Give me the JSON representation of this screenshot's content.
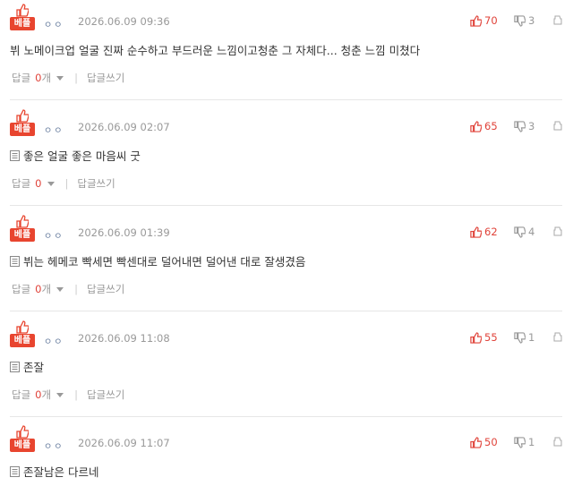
{
  "labels": {
    "best": "베플",
    "reply": "답글",
    "reply_unit": "개",
    "write_reply": "답글쓰기"
  },
  "colors": {
    "best_badge": "#e8452f",
    "upvote": "#e0433a",
    "meta": "#999999",
    "nickname": "#6a7fa0"
  },
  "comments": [
    {
      "nickname": "ㅇㅇ",
      "date": "2026.06.09 09:36",
      "up": "70",
      "down": "3",
      "text": "뷔 노메이크업 얼굴 진짜 순수하고 부드러운 느낌이고청춘 그 자체다... 청춘 느낌 미쳤다",
      "replies": "0",
      "has_doc_icon": false
    },
    {
      "nickname": "ㅇㅇ",
      "date": "2026.06.09 02:07",
      "up": "65",
      "down": "3",
      "text": "좋은 얼굴 좋은 마음씨 굿",
      "replies": "0",
      "has_doc_icon": true
    },
    {
      "nickname": "ㅇㅇ",
      "date": "2026.06.09 01:39",
      "up": "62",
      "down": "4",
      "text": "뷔는 헤메코 빡세면 빡센대로 덜어내면 덜어낸 대로 잘생겼음",
      "replies": "0",
      "has_doc_icon": true
    },
    {
      "nickname": "ㅇㅇ",
      "date": "2026.06.09 11:08",
      "up": "55",
      "down": "1",
      "text": "존잘",
      "replies": "0",
      "has_doc_icon": true
    },
    {
      "nickname": "ㅇㅇ",
      "date": "2026.06.09 11:07",
      "up": "50",
      "down": "1",
      "text": "존잘남은 다르네",
      "replies": "0",
      "has_doc_icon": true
    }
  ]
}
